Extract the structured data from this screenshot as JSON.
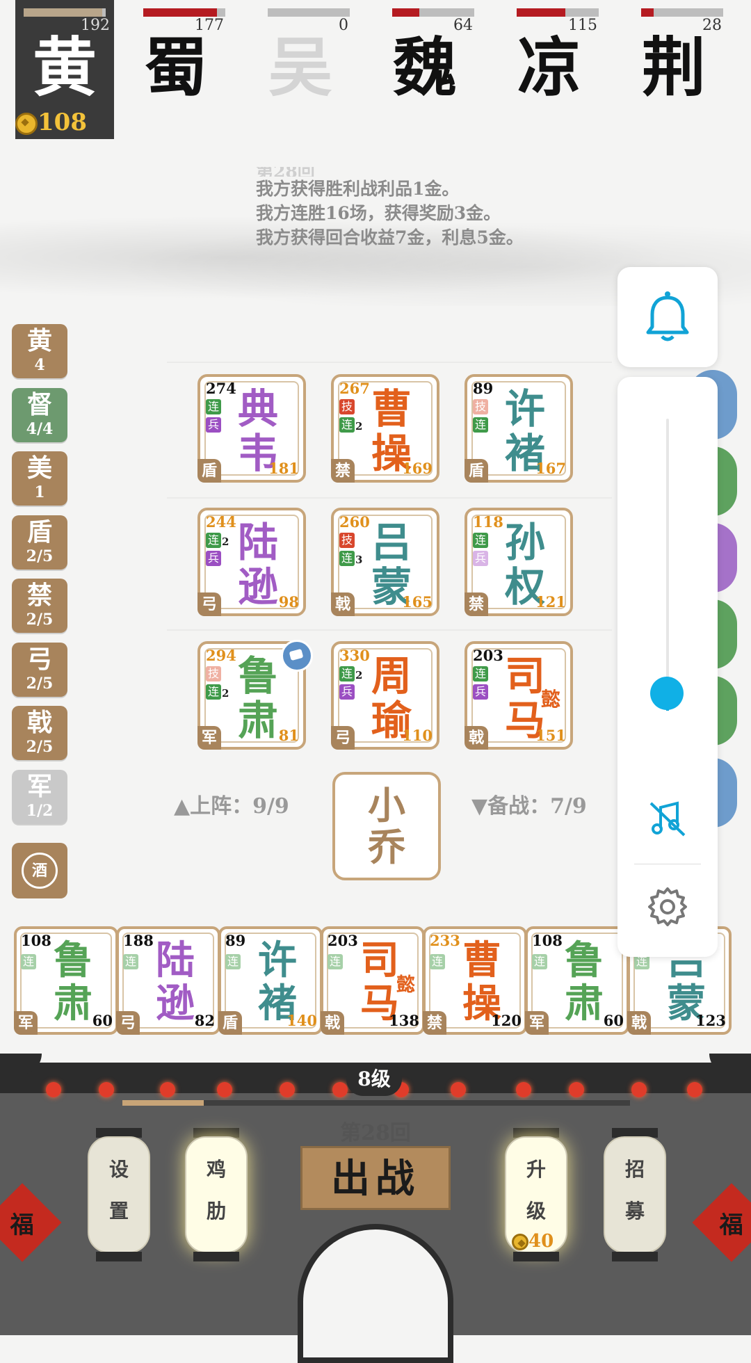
{
  "player": {
    "name": "黄",
    "hp": "192",
    "hp_fraction": 0.96,
    "gold": "108"
  },
  "opponents": [
    {
      "name": "蜀",
      "hp": "177",
      "hp_fraction": 0.9,
      "alive": true
    },
    {
      "name": "吴",
      "hp": "0",
      "hp_fraction": 0.0,
      "alive": false
    },
    {
      "name": "魏",
      "hp": "64",
      "hp_fraction": 0.33,
      "alive": true
    },
    {
      "name": "凉",
      "hp": "115",
      "hp_fraction": 0.59,
      "alive": true
    },
    {
      "name": "荆",
      "hp": "28",
      "hp_fraction": 0.15,
      "alive": true
    }
  ],
  "log": {
    "faded": "第28回",
    "lines": [
      "我方获得胜利战利品1金。",
      "我方连胜16场，获得奖励3金。",
      "我方获得回合收益7金，利息5金。"
    ]
  },
  "traits": [
    {
      "name": "黄",
      "count": "4",
      "state": "normal"
    },
    {
      "name": "督",
      "count": "4/4",
      "state": "active"
    },
    {
      "name": "美",
      "count": "1",
      "state": "normal"
    },
    {
      "name": "盾",
      "count": "2/5",
      "state": "normal"
    },
    {
      "name": "禁",
      "count": "2/5",
      "state": "normal"
    },
    {
      "name": "弓",
      "count": "2/5",
      "state": "normal"
    },
    {
      "name": "戟",
      "count": "2/5",
      "state": "normal"
    },
    {
      "name": "军",
      "count": "1/2",
      "state": "off"
    }
  ],
  "wine_label": "酒",
  "board": [
    {
      "hp": "274",
      "hp_gold": false,
      "name": "典韦",
      "extra": "",
      "color": "purple",
      "atk": "181",
      "cls": "盾",
      "tags": [
        [
          "连",
          "g",
          ""
        ],
        [
          "兵",
          "p",
          ""
        ]
      ]
    },
    {
      "hp": "267",
      "hp_gold": true,
      "name": "曹操",
      "extra": "",
      "color": "orange",
      "atk": "169",
      "cls": "禁",
      "tags": [
        [
          "技",
          "r",
          ""
        ],
        [
          "连",
          "g",
          "2"
        ]
      ]
    },
    {
      "hp": "89",
      "hp_gold": false,
      "name": "许褚",
      "extra": "",
      "color": "teal",
      "atk": "167",
      "cls": "盾",
      "tags": [
        [
          "技",
          "lr",
          ""
        ],
        [
          "连",
          "g",
          ""
        ]
      ]
    },
    {
      "hp": "244",
      "hp_gold": true,
      "name": "陆逊",
      "extra": "",
      "color": "purple",
      "atk": "98",
      "cls": "弓",
      "tags": [
        [
          "连",
          "g",
          "2"
        ],
        [
          "兵",
          "p",
          ""
        ]
      ]
    },
    {
      "hp": "260",
      "hp_gold": true,
      "name": "吕蒙",
      "extra": "",
      "color": "teal",
      "atk": "165",
      "cls": "戟",
      "tags": [
        [
          "技",
          "r",
          ""
        ],
        [
          "连",
          "g",
          "3"
        ]
      ]
    },
    {
      "hp": "118",
      "hp_gold": true,
      "name": "孙权",
      "extra": "",
      "color": "teal",
      "atk": "121",
      "cls": "禁",
      "tags": [
        [
          "连",
          "g",
          ""
        ],
        [
          "兵",
          "lp",
          ""
        ]
      ]
    },
    {
      "hp": "294",
      "hp_gold": true,
      "name": "鲁肃",
      "extra": "",
      "color": "green",
      "atk": "81",
      "cls": "军",
      "tags": [
        [
          "技",
          "lr",
          ""
        ],
        [
          "连",
          "g",
          "2"
        ]
      ]
    },
    {
      "hp": "330",
      "hp_gold": true,
      "name": "周瑜",
      "extra": "",
      "color": "orange",
      "atk": "110",
      "cls": "弓",
      "tags": [
        [
          "连",
          "g",
          "2"
        ],
        [
          "兵",
          "p",
          ""
        ]
      ]
    },
    {
      "hp": "203",
      "hp_gold": false,
      "name": "司马",
      "extra": "懿",
      "color": "orange",
      "atk": "151",
      "cls": "戟",
      "tags": [
        [
          "连",
          "g",
          ""
        ],
        [
          "兵",
          "p",
          ""
        ]
      ]
    }
  ],
  "board_status": {
    "deployed": "▲上阵：9/9",
    "reserve": "▼备战：7/9"
  },
  "coach": {
    "name": "小乔"
  },
  "bench": [
    {
      "hp": "108",
      "hp_gold": false,
      "name": "鲁肃",
      "extra": "",
      "color": "green",
      "atk": "60",
      "atk_gold": false,
      "cls": "军"
    },
    {
      "hp": "188",
      "hp_gold": false,
      "name": "陆逊",
      "extra": "",
      "color": "purple",
      "atk": "82",
      "atk_gold": false,
      "cls": "弓"
    },
    {
      "hp": "89",
      "hp_gold": false,
      "name": "许褚",
      "extra": "",
      "color": "teal",
      "atk": "140",
      "atk_gold": true,
      "cls": "盾"
    },
    {
      "hp": "203",
      "hp_gold": false,
      "name": "司马",
      "extra": "懿",
      "color": "orange",
      "atk": "138",
      "atk_gold": false,
      "cls": "戟"
    },
    {
      "hp": "233",
      "hp_gold": true,
      "name": "曹操",
      "extra": "",
      "color": "orange",
      "atk": "120",
      "atk_gold": false,
      "cls": "禁"
    },
    {
      "hp": "108",
      "hp_gold": false,
      "name": "鲁肃",
      "extra": "",
      "color": "green",
      "atk": "60",
      "atk_gold": false,
      "cls": "军"
    },
    {
      "hp": "",
      "hp_gold": false,
      "name": "吕蒙",
      "extra": "",
      "color": "teal",
      "atk": "123",
      "atk_gold": false,
      "cls": "戟"
    }
  ],
  "level": {
    "label": "8级",
    "exp_fraction": 0.16
  },
  "round": "第28回",
  "fight_button": "出战",
  "lanterns": [
    {
      "name": "setting",
      "text": "设置",
      "lit": false,
      "cost": ""
    },
    {
      "name": "chicken",
      "text": "鸡肋",
      "lit": true,
      "cost": ""
    },
    {
      "name": "upgrade",
      "text": "升级",
      "lit": true,
      "cost": "40"
    },
    {
      "name": "recruit",
      "text": "招募",
      "lit": false,
      "cost": ""
    }
  ],
  "volume": {
    "level_fraction": 0.06
  },
  "colors": {
    "accent": "#11a3d6",
    "card_border": "#c7a57a",
    "trait_bg": "#a8845c",
    "trait_active": "#6d9a6f",
    "hp_red": "#b51b21"
  },
  "icons": [
    "bell-icon",
    "music-off-icon",
    "gear-icon",
    "coin-icon",
    "wine-icon"
  ]
}
